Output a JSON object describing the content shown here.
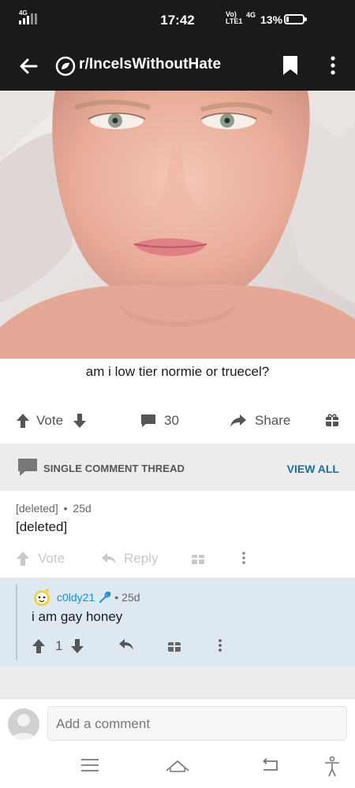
{
  "status_bar": {
    "signal_label": "4G",
    "time": "17:42",
    "network_line1": "Vo)",
    "network_line2": "LTE1",
    "network_2": "4G",
    "battery_percent": "13%",
    "battery_level": 0.13
  },
  "header": {
    "back_icon": "arrow-left-icon",
    "subreddit": "r/IncelsWithoutHate",
    "bookmark_icon": "bookmark-icon",
    "more_icon": "more-vertical-icon"
  },
  "post": {
    "image_description_icon": "post-photo",
    "title": "am i low tier normie or truecel?",
    "vote_label": "Vote",
    "comment_count": "30",
    "share_label": "Share"
  },
  "thread_banner": {
    "label": "SINGLE COMMENT THREAD",
    "view_all": "VIEW ALL"
  },
  "comment1": {
    "author": "[deleted]",
    "separator": "•",
    "age": "25d",
    "body": "[deleted]",
    "vote_label": "Vote",
    "reply_label": "Reply"
  },
  "comment2": {
    "author": "c0ldy21",
    "separator": "•",
    "age": "25d",
    "body": "i am gay honey",
    "score": "1"
  },
  "composer": {
    "placeholder": "Add a comment"
  },
  "colors": {
    "header_bg": "#1a1a1a",
    "accent_link": "#1b6ea8",
    "username": "#1b8fd6",
    "reply_bg": "#dde8f1"
  }
}
